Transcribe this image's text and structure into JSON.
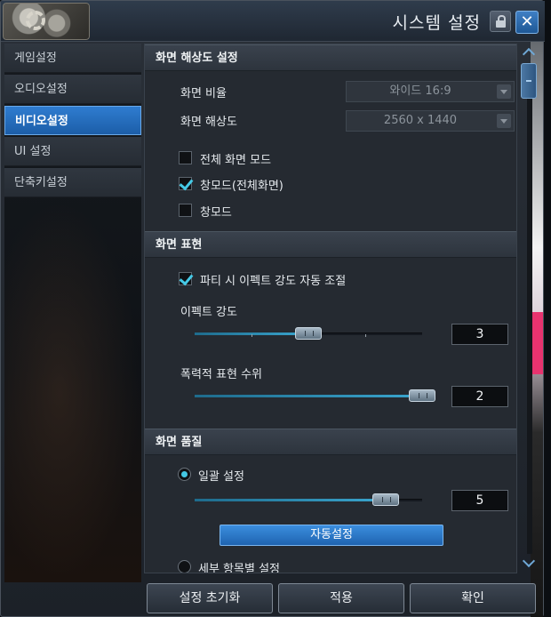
{
  "window": {
    "title": "시스템 설정",
    "close_glyph": "✕",
    "icons": {
      "logo": "gear-logo-icon",
      "lock": "lock-icon",
      "close": "close-icon"
    }
  },
  "sidebar": {
    "items": [
      {
        "label": "게임설정",
        "active": false
      },
      {
        "label": "오디오설정",
        "active": false
      },
      {
        "label": "비디오설정",
        "active": true
      },
      {
        "label": "UI 설정",
        "active": false
      },
      {
        "label": "단축키설정",
        "active": false
      }
    ]
  },
  "resolution_section": {
    "header": "화면 해상도 설정",
    "aspect_label": "화면 비율",
    "aspect_value": "와이드 16:9",
    "resolution_label": "화면 해상도",
    "resolution_value": "2560 x 1440",
    "fullscreen": {
      "label": "전체 화면 모드",
      "checked": false
    },
    "windowed_fullscreen": {
      "label": "창모드(전체화면)",
      "checked": true
    },
    "windowed": {
      "label": "창모드",
      "checked": false
    }
  },
  "display_section": {
    "header": "화면 표현",
    "party_effect": {
      "label": "파티 시 이펙트 강도 자동 조절",
      "checked": true
    },
    "effect_intensity": {
      "label": "이펙트 강도",
      "value": "3",
      "fraction": 0.5
    },
    "violence_level": {
      "label": "폭력적 표현 수위",
      "value": "2",
      "fraction": 1.0
    }
  },
  "quality_section": {
    "header": "화면 품질",
    "bulk": {
      "label": "일괄 설정",
      "selected": true,
      "value": "5",
      "fraction": 0.84
    },
    "auto_button": "자동설정",
    "detailed": {
      "label": "세부 항목별 설정",
      "selected": false
    }
  },
  "footer": {
    "reset": "설정 초기화",
    "apply": "적용",
    "confirm": "확인"
  },
  "colors": {
    "accent": "#2f7cd0",
    "check": "#45c9e6"
  }
}
